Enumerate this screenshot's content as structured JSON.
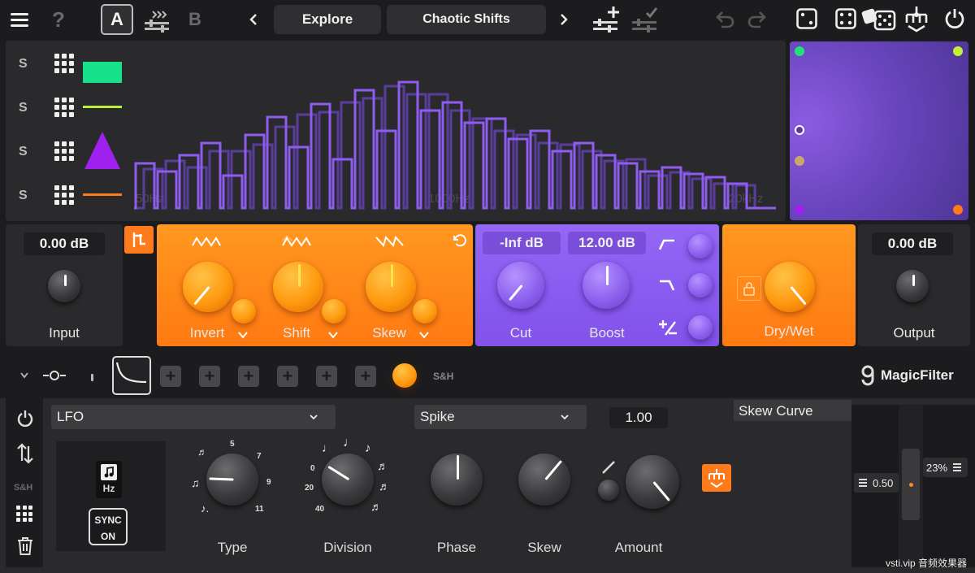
{
  "toolbar": {
    "preset_a": "A",
    "preset_b": "B",
    "explore_label": "Explore",
    "preset_name": "Chaotic Shifts"
  },
  "spectrum": {
    "band_solo_labels": [
      "S",
      "S",
      "S",
      "S"
    ],
    "freq_labels": [
      "50Hz",
      "1000Hz",
      "20kHz"
    ]
  },
  "input": {
    "value": "0.00 dB",
    "label": "Input"
  },
  "shift_module": {
    "labels": [
      "Invert",
      "Shift",
      "Skew"
    ]
  },
  "boost_module": {
    "cut_value": "-Inf dB",
    "boost_value": "12.00 dB",
    "cut_label": "Cut",
    "boost_label": "Boost"
  },
  "drywet": {
    "label": "Dry/Wet"
  },
  "output": {
    "value": "0.00 dB",
    "label": "Output"
  },
  "mod_strip": {
    "sh_label": "S&H",
    "brand": "MagicFilter"
  },
  "lfo": {
    "source": "LFO",
    "shape": "Spike",
    "amount_value": "1.00",
    "side_sh_label": "S&H",
    "hz_label": "Hz",
    "sync_label": "SYNC",
    "sync_state": "ON",
    "type_ticks": [
      "5",
      "7",
      "9",
      "11"
    ],
    "division_ticks": [
      "0",
      "20",
      "40"
    ],
    "knob_labels": [
      "Type",
      "Division",
      "Phase",
      "Skew",
      "Amount"
    ],
    "skew_curve_title": "Skew Curve",
    "skew_curve_value": "0.50",
    "percent_value": "23%"
  },
  "watermark": "vsti.vip 音频效果器",
  "colors": {
    "accent_orange": "#ff8a1a",
    "accent_purple": "#8a5cf0",
    "band_green": "#16e089",
    "band_lime": "#b8f03a",
    "band_violet": "#a020f0",
    "band_orange": "#ff7a1a"
  }
}
